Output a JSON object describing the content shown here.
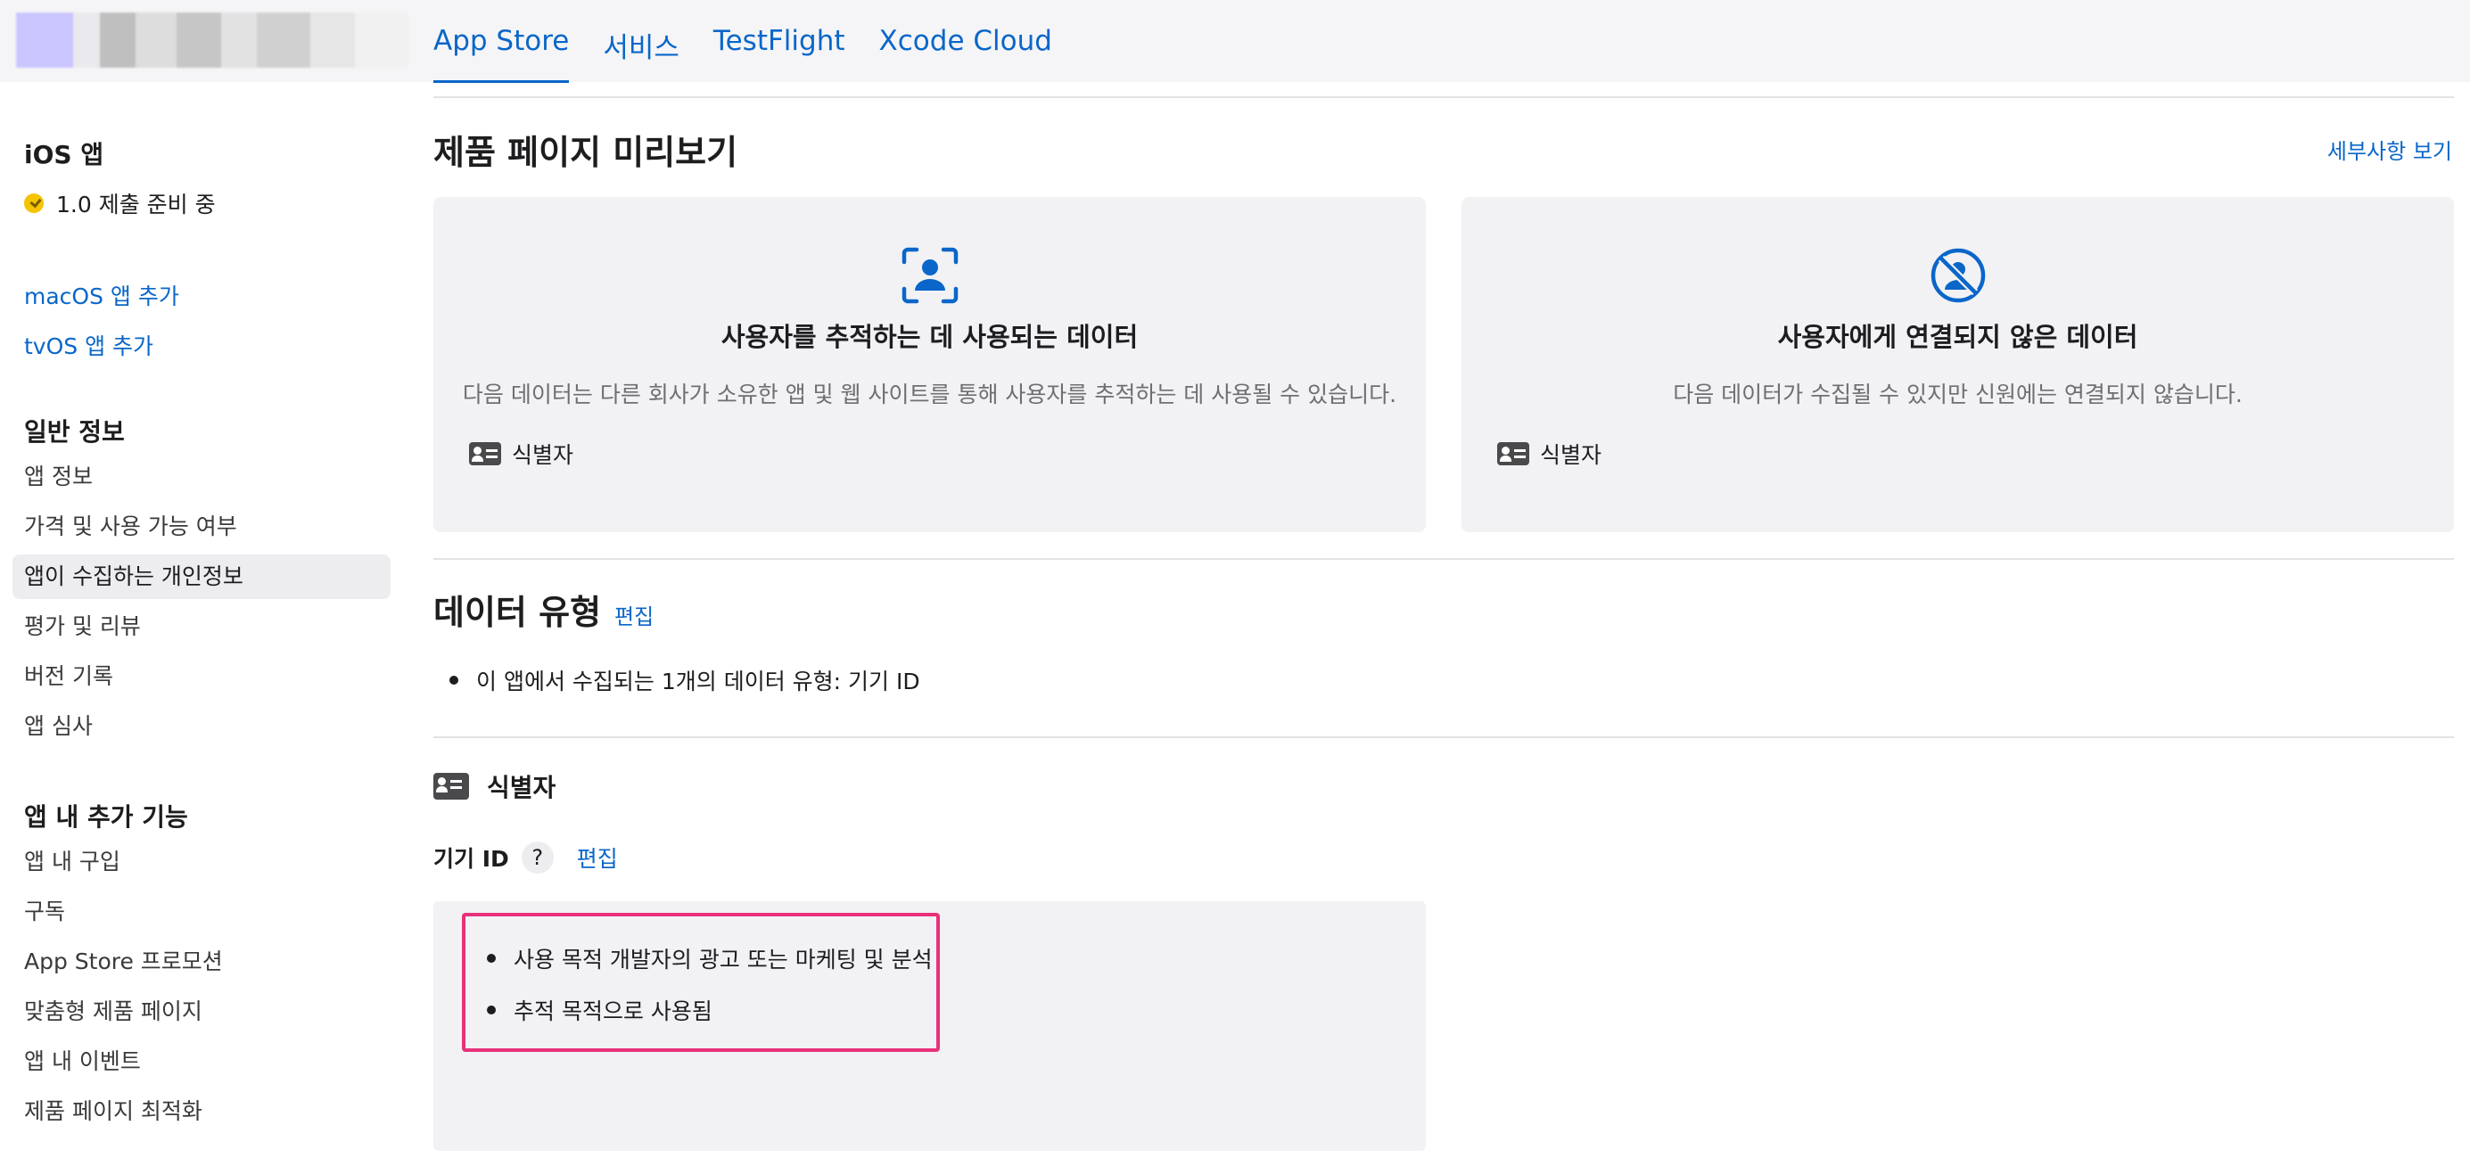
{
  "nav": {
    "tabs": [
      {
        "label": "App Store",
        "active": true
      },
      {
        "label": "서비스",
        "active": false
      },
      {
        "label": "TestFlight",
        "active": false
      },
      {
        "label": "Xcode Cloud",
        "active": false
      }
    ]
  },
  "sidebar": {
    "ios_heading": "iOS 앱",
    "status": "1.0 제출 준비 중",
    "add_macos": "macOS 앱 추가",
    "add_tvos": "tvOS 앱 추가",
    "general_heading": "일반 정보",
    "general_items": [
      "앱 정보",
      "가격 및 사용 가능 여부",
      "앱이 수집하는 개인정보",
      "평가 및 리뷰",
      "버전 기록",
      "앱 심사"
    ],
    "iap_heading": "앱 내 추가 기능",
    "iap_items": [
      "앱 내 구입",
      "구독",
      "App Store 프로모션",
      "맞춤형 제품 페이지",
      "앱 내 이벤트",
      "제품 페이지 최적화"
    ]
  },
  "preview": {
    "title": "제품 페이지 미리보기",
    "details_link": "세부사항 보기",
    "card_tracking": {
      "title": "사용자를 추적하는 데 사용되는 데이터",
      "desc": "다음 데이터는 다른 회사가 소유한 앱 및 웹 사이트를 통해 사용자를 추적하는 데 사용될 수 있습니다.",
      "tag": "식별자"
    },
    "card_not_linked": {
      "title": "사용자에게 연결되지 않은 데이터",
      "desc": "다음 데이터가 수집될 수 있지만 신원에는 연결되지 않습니다.",
      "tag": "식별자"
    }
  },
  "data_types": {
    "title": "데이터 유형",
    "edit": "편집",
    "summary": "이 앱에서 수집되는 1개의 데이터 유형: 기기 ID"
  },
  "identifier": {
    "heading": "식별자",
    "device_id_label": "기기 ID",
    "help": "?",
    "edit": "편집",
    "purposes": [
      "사용 목적 개발자의 광고 또는 마케팅 및 분석",
      "추적 목적으로 사용됨"
    ]
  },
  "colors": {
    "accent": "#0a66c9",
    "highlight": "#e8317a",
    "status": "#f5c400"
  }
}
